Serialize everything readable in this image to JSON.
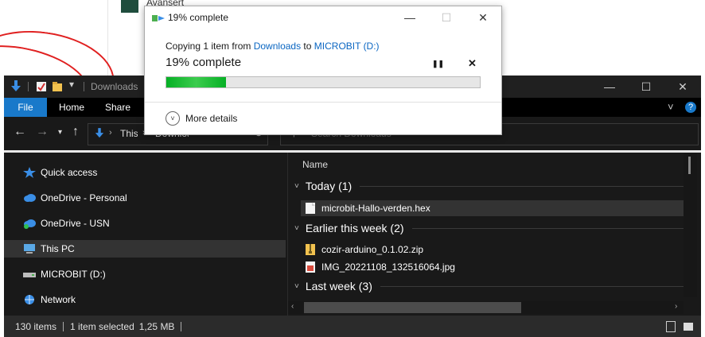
{
  "background": {
    "top_label": "Avansert"
  },
  "copy_dialog": {
    "title": "19% complete",
    "status_prefix": "Copying 1 item from ",
    "source": "Downloads",
    "to_word": " to ",
    "destination": "MICROBIT (D:)",
    "percent_text": "19% complete",
    "progress": 0.19,
    "pause_glyph": "❚❚",
    "cancel_glyph": "✕",
    "more_details_label": "More details",
    "minimize_glyph": "—",
    "maximize_glyph": "☐",
    "close_glyph": "✕"
  },
  "explorer": {
    "title": "Downloads",
    "window_controls": {
      "minimize": "—",
      "maximize": "☐",
      "close": "✕"
    },
    "ribbon_tabs": [
      "File",
      "Home",
      "Share"
    ],
    "ribbon_right": {
      "collapse": "˅",
      "help": "?"
    },
    "address": {
      "segment1": "This PC",
      "segment2": "Downloads"
    },
    "search_placeholder": "Search Downloads",
    "nav_pane": [
      {
        "label": "Quick access",
        "icon": "star-icon"
      },
      {
        "label": "OneDrive - Personal",
        "icon": "cloud-icon"
      },
      {
        "label": "OneDrive - USN",
        "icon": "cloud-icon"
      },
      {
        "label": "This PC",
        "icon": "computer-icon",
        "selected": true
      },
      {
        "label": "MICROBIT (D:)",
        "icon": "drive-icon"
      },
      {
        "label": "Network",
        "icon": "network-icon"
      }
    ],
    "column_name": "Name",
    "groups": [
      {
        "title": "Today (1)",
        "files": [
          {
            "name": "microbit-Hallo-verden.hex",
            "icon": "document-icon",
            "selected": true
          }
        ]
      },
      {
        "title": "Earlier this week (2)",
        "files": [
          {
            "name": "cozir-arduino_0.1.02.zip",
            "icon": "zip-icon"
          },
          {
            "name": "IMG_20221108_132516064.jpg",
            "icon": "image-icon"
          }
        ]
      },
      {
        "title": "Last week (3)",
        "files": []
      }
    ],
    "status": {
      "item_count": "130 items",
      "selection": "1 item selected",
      "size": "1,25 MB"
    }
  },
  "colors": {
    "accent_blue": "#1979ca",
    "progress_green": "#06b025",
    "link_blue": "#0a66c2"
  }
}
